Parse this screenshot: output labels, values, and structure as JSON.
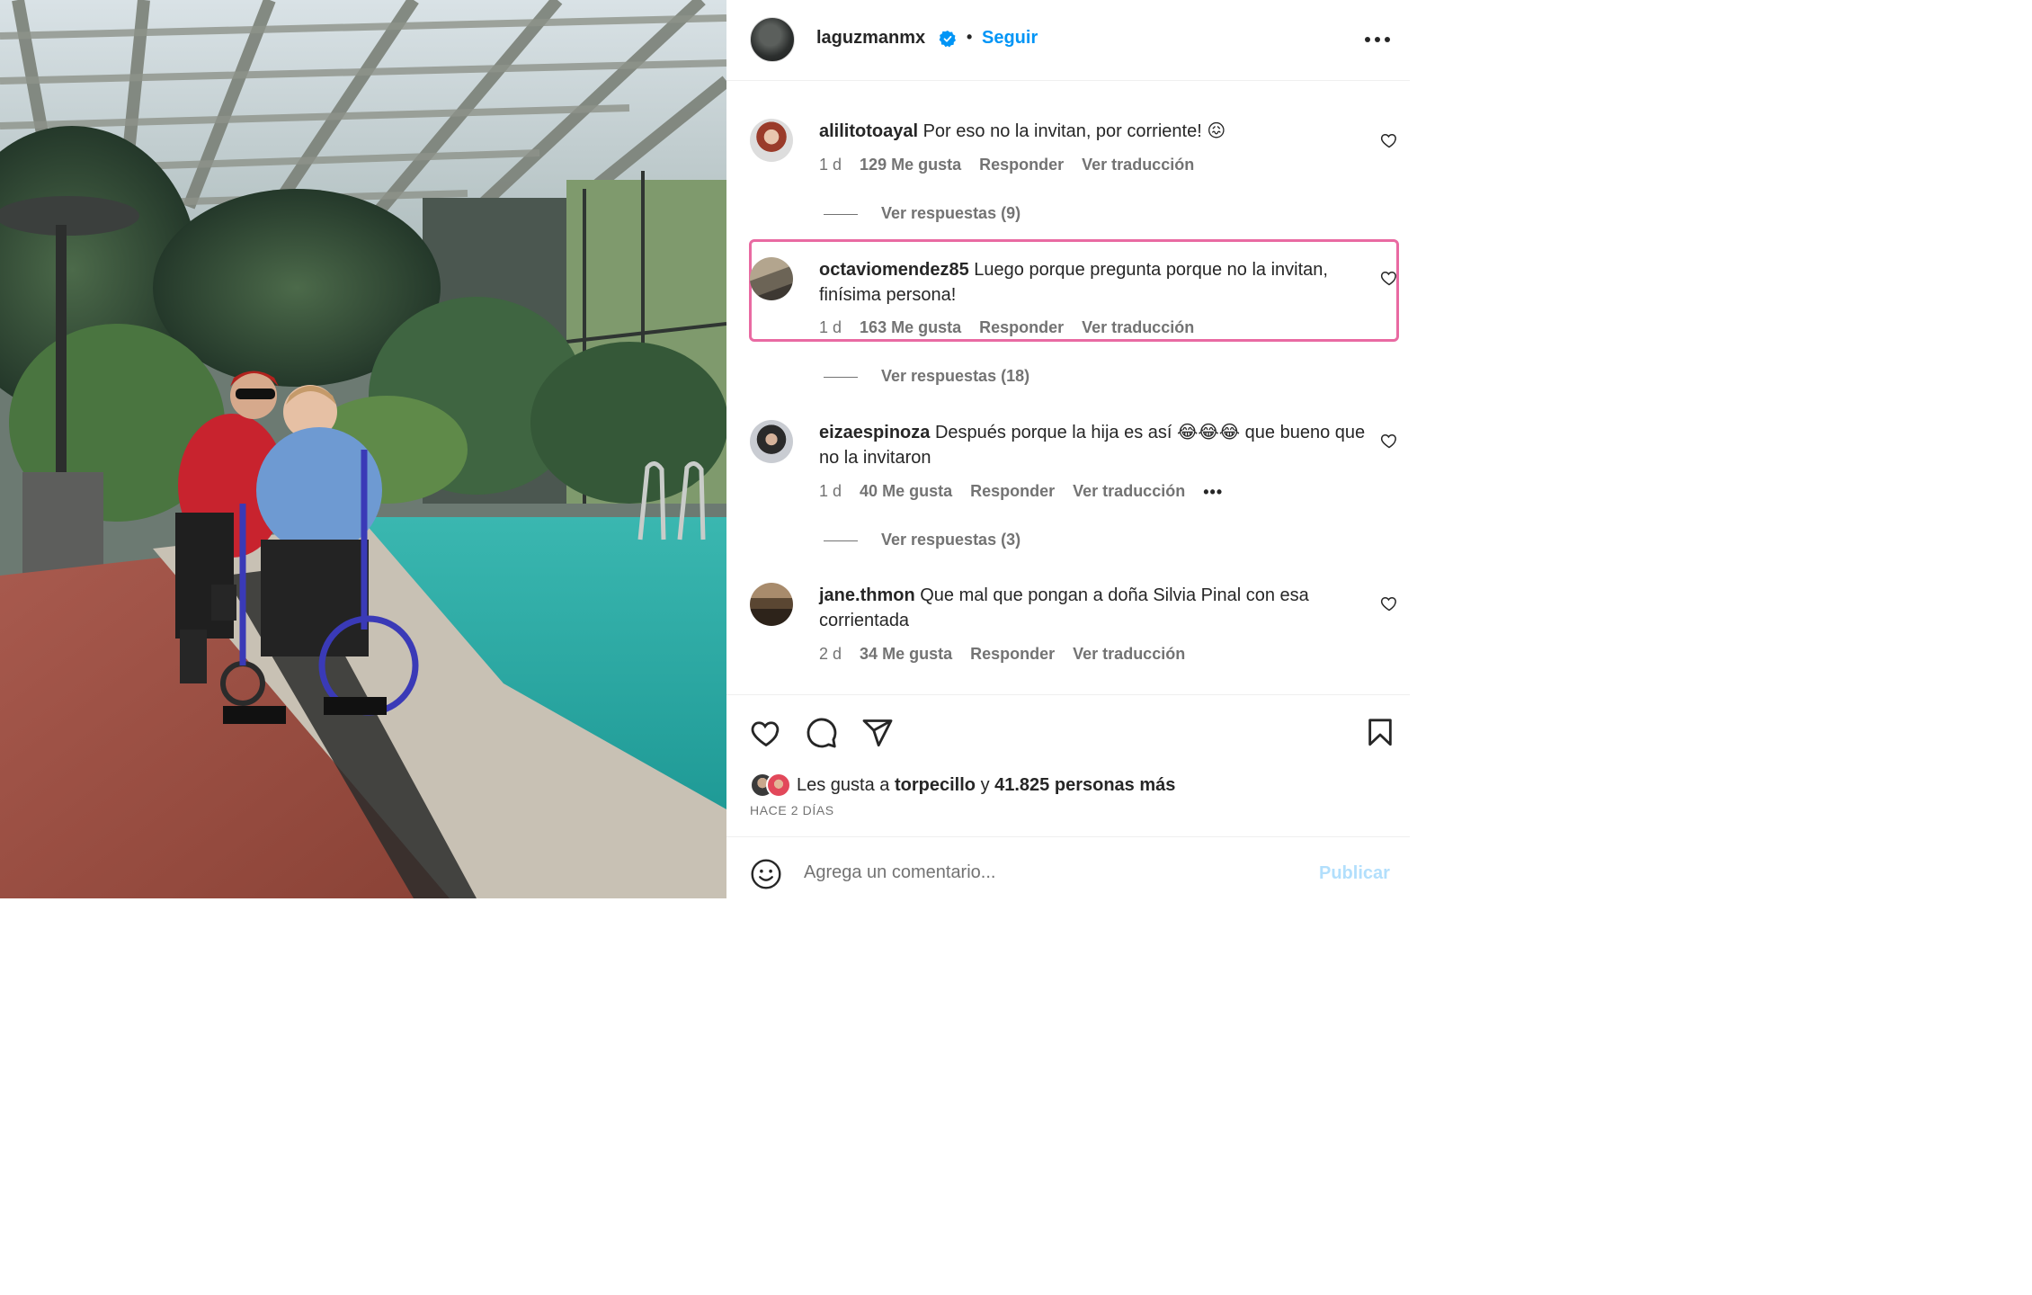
{
  "colors": {
    "accent": "#0095f6",
    "text": "#262626",
    "muted": "#737373",
    "highlight": "#e96aa2",
    "publish_disabled": "#b2dffc"
  },
  "header": {
    "username": "laguzmanmx",
    "separator": "•",
    "follow_label": "Seguir",
    "verified_icon": "verified-badge-icon",
    "more_icon": "more-horizontal-icon"
  },
  "comments": [
    {
      "username": "alilitotoayal",
      "text": "Por eso no la invitan, por corriente! 😖",
      "time": "1 d",
      "likes": "129 Me gusta",
      "reply": "Responder",
      "translate": "Ver traducción",
      "replies": "Ver respuestas (9)"
    },
    {
      "username": "octaviomendez85",
      "text": "Luego porque pregunta porque no la invitan, finísima persona!",
      "time": "1 d",
      "likes": "163 Me gusta",
      "reply": "Responder",
      "translate": "Ver traducción",
      "replies": "Ver respuestas (18)",
      "highlighted": true
    },
    {
      "username": "eizaespinoza",
      "text": "Después porque la hija es así 😂😂😂 que bueno que no la invitaron",
      "time": "1 d",
      "likes": "40 Me gusta",
      "reply": "Responder",
      "translate": "Ver traducción",
      "replies": "Ver respuestas (3)",
      "more": "•••"
    },
    {
      "username": "jane.thmon",
      "text": "Que mal que pongan a doña Silvia Pinal con esa corrientada",
      "time": "2 d",
      "likes": "34 Me gusta",
      "reply": "Responder",
      "translate": "Ver traducción"
    }
  ],
  "actions": {
    "icons": [
      "heart-icon",
      "comment-icon",
      "share-icon",
      "bookmark-icon"
    ]
  },
  "likes": {
    "prefix": "Les gusta a",
    "user": "torpecillo",
    "joiner": "y",
    "count": "41.825 personas más"
  },
  "posted": "HACE 2 DÍAS",
  "add_comment": {
    "placeholder": "Agrega un comentario...",
    "publish_label": "Publicar",
    "emoji_icon": "emoji-icon"
  }
}
